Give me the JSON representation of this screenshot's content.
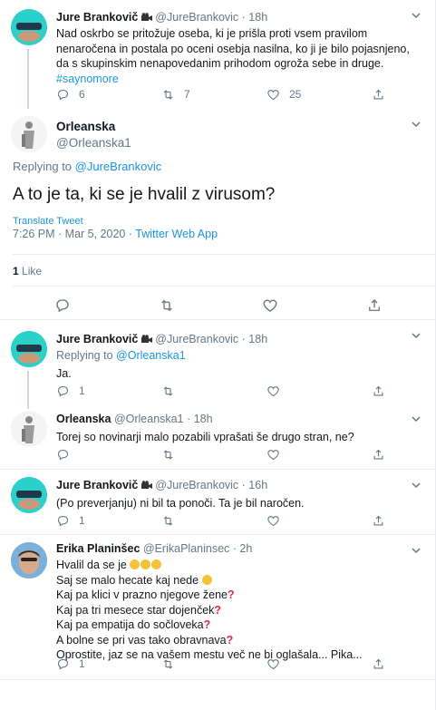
{
  "tweet1": {
    "name": "Jure Brankovič",
    "handle": "@JureBrankovic",
    "time": "· 18h",
    "text": "Nad oskrbo se pritožuje oseba, ki je prišla proti vsem pravilom nenaročena in postala po oceni osebja nasilna, ko ji je bilo pojasnjeno, da s skupinskim nenapovedanim prihodom ogroža sebe in druge.",
    "hashtag": "#saynomore",
    "replies": "6",
    "retweets": "7",
    "likes": "25"
  },
  "main": {
    "name": "Orleanska",
    "handle": "@Orleanska1",
    "replying_prefix": "Replying to",
    "replying_to": "@JureBrankovic",
    "text": "A to je ta, ki se je hvalil z virusom?",
    "translate": "Translate Tweet",
    "datetime": "7:26 PM · Mar 5, 2020 ·",
    "source": "Twitter Web App",
    "likes_count": "1",
    "likes_label": "Like"
  },
  "reply1": {
    "name": "Jure Brankovič",
    "handle": "@JureBrankovic",
    "time": "· 18h",
    "replying_prefix": "Replying to",
    "replying_to": "@Orleanska1",
    "text": "Ja.",
    "replies": "1"
  },
  "reply2": {
    "name": "Orleanska",
    "handle": "@Orleanska1",
    "time": "· 18h",
    "text": "Torej so novinarji malo pozabili vprašati še drugo stran, ne?"
  },
  "reply3": {
    "name": "Jure Brankovič",
    "handle": "@JureBrankovic",
    "time": "· 16h",
    "text": "(Po preverjanju) ni bil ta ponoči. Ta je bil naročen.",
    "replies": "1"
  },
  "reply4": {
    "name": "Erika Planinšec",
    "handle": "@ErikaPlaninsec",
    "time": "· 2h",
    "line1": "Hvalil da se je",
    "line2": "Saj se malo hecate kaj nede",
    "line3": "Kaj pa klici v prazno njegove žene",
    "line4": "Kaj pa tri mesece star dojenček",
    "line5": "Kaj pa empatija do sočloveka",
    "line6": "A bolne se pri vas tako obravnava",
    "line7": "Oprostite, jaz se na vašem mestu več ne bi oglašala... Pika...",
    "replies": "1"
  },
  "icons": {
    "reply": "reply-icon",
    "retweet": "retweet-icon",
    "like": "heart-icon",
    "share": "share-icon",
    "more": "chevron-down-icon",
    "camera": "camera-icon"
  },
  "colors": {
    "link": "#1b95e0",
    "muted": "#657786",
    "divider": "#e6ecf0",
    "question": "#dd2e44"
  }
}
